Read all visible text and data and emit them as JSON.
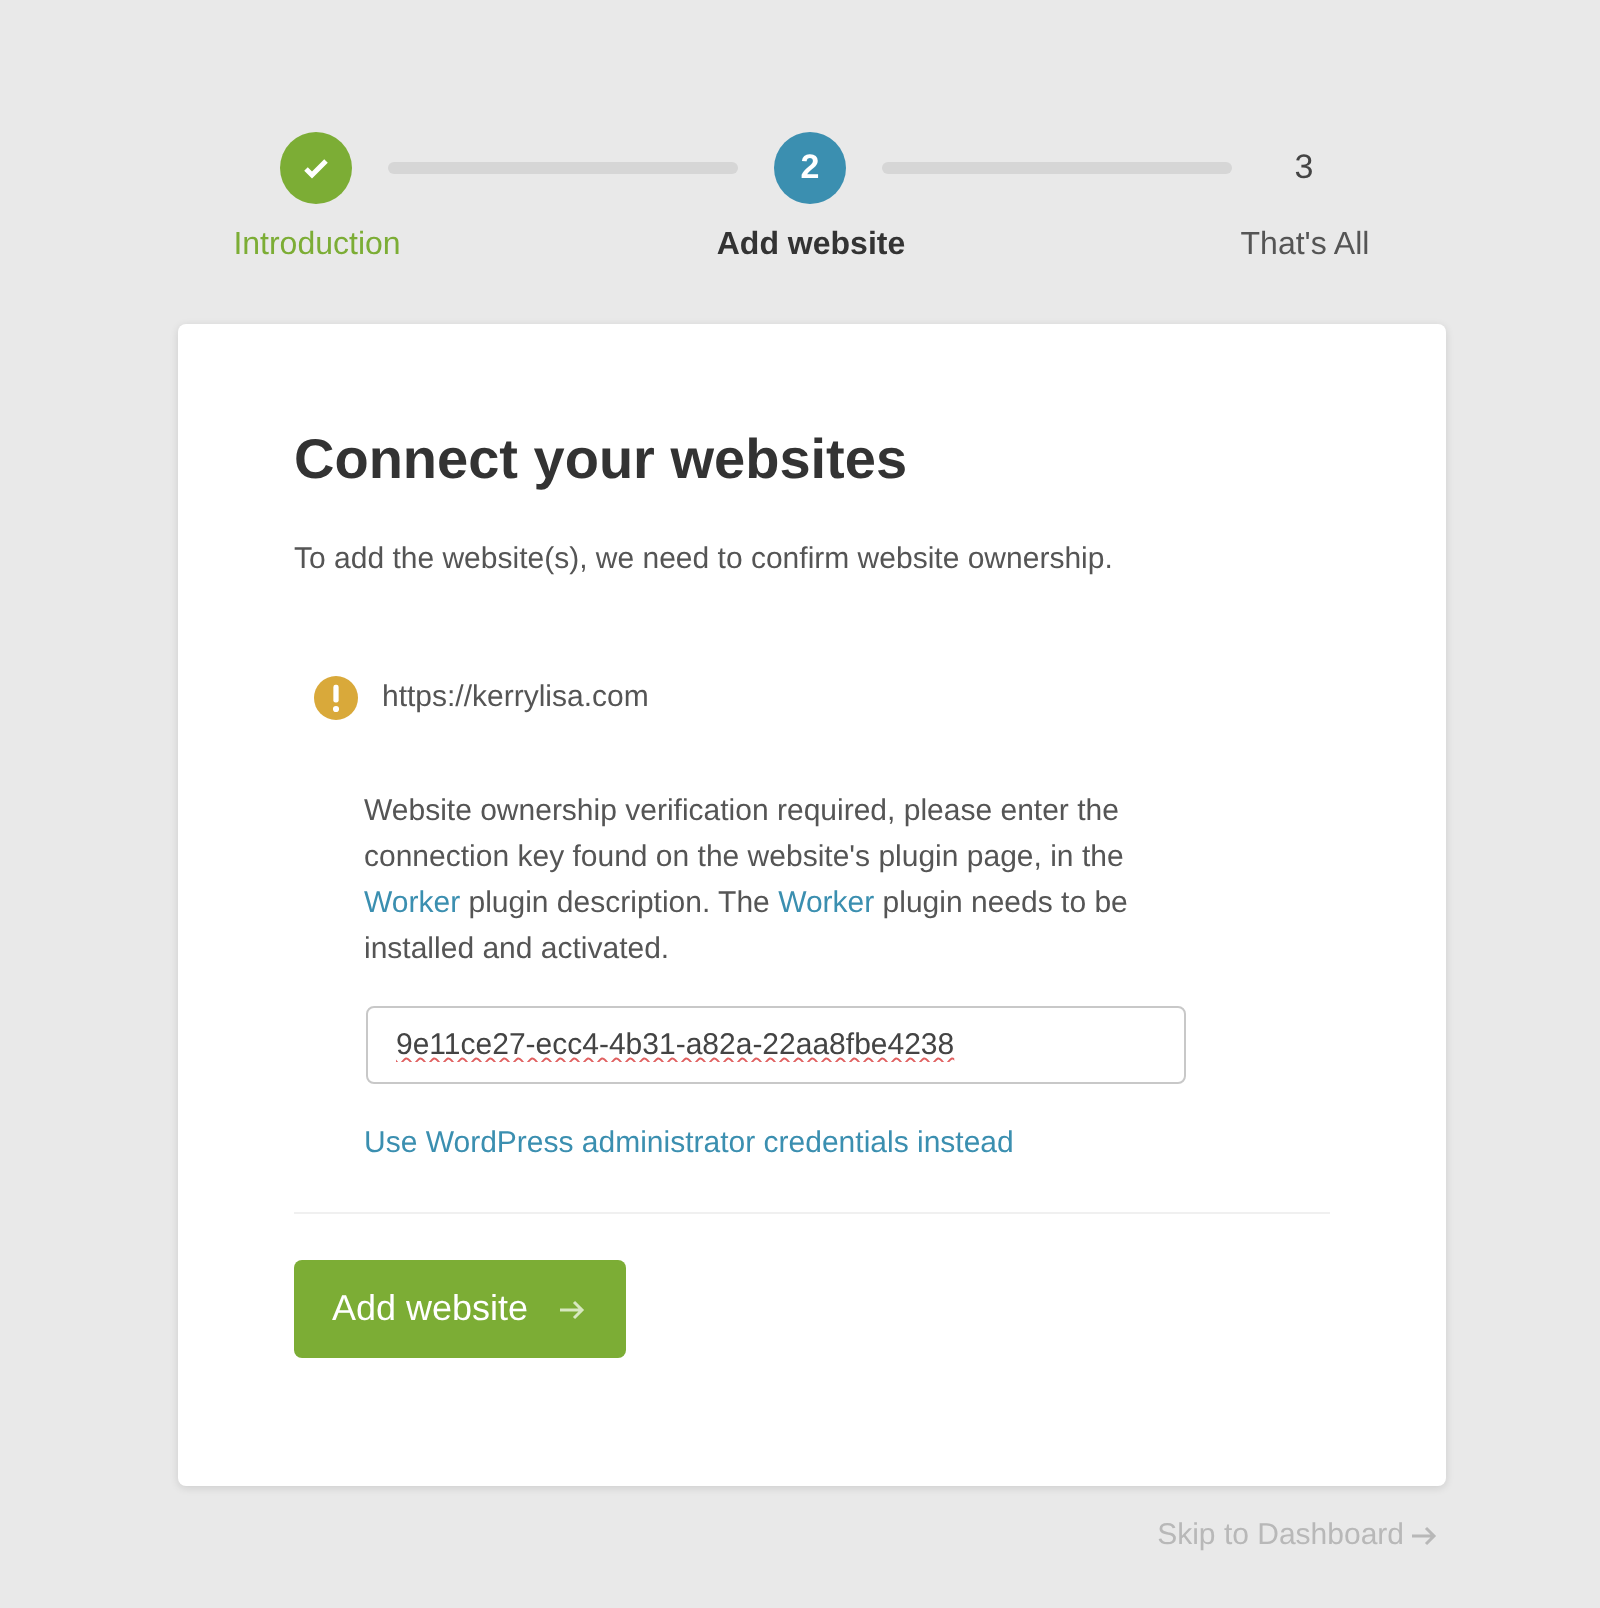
{
  "steps": [
    {
      "label": "Introduction",
      "kind": "done"
    },
    {
      "label": "Add website",
      "marker": "2",
      "kind": "current"
    },
    {
      "label": "That's All",
      "marker": "3",
      "kind": "pending"
    }
  ],
  "card": {
    "title": "Connect your websites",
    "subtitle": "To add the website(s), we need to confirm website ownership.",
    "site": {
      "url": "https://kerrylisa.com",
      "kind": "warning"
    },
    "description": [
      {
        "kind": "text",
        "text": "Website ownership verification required, please enter the connection key found on the website's plugin page, in the "
      },
      {
        "kind": "link",
        "text": "Worker"
      },
      {
        "kind": "text",
        "text": " plugin description. The "
      },
      {
        "kind": "link",
        "text": "Worker"
      },
      {
        "kind": "text",
        "text": " plugin needs to be installed and activated."
      }
    ],
    "key_field": {
      "value": "9e11ce27-ecc4-4b31-a82a-22aa8fbe4238"
    },
    "alt_link": "Use WordPress administrator credentials instead",
    "submit": "Add website"
  },
  "skip_link": "Skip to Dashboard"
}
